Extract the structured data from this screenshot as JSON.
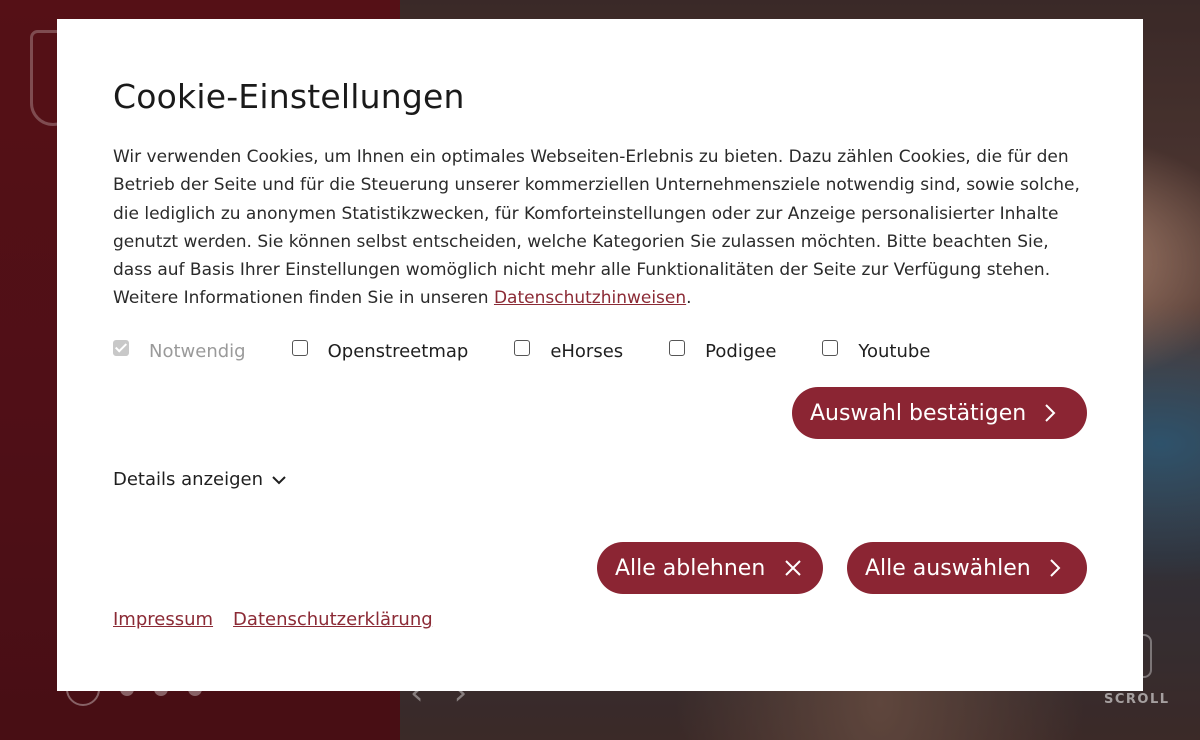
{
  "modal": {
    "title": "Cookie-Einstellungen",
    "text_before_link": "Wir verwenden Cookies, um Ihnen ein optimales Webseiten-Erlebnis zu bieten. Dazu zählen Cookies, die für den Betrieb der Seite und für die Steuerung unserer kommerziellen Unternehmensziele notwendig sind, sowie solche, die lediglich zu anonymen Statistikzwecken, für Komforteinstellungen oder zur Anzeige personalisierter Inhalte genutzt werden. Sie können selbst entscheiden, welche Kategorien Sie zulassen möchten. Bitte beachten Sie, dass auf Basis Ihrer Einstellungen womöglich nicht mehr alle Funktionalitäten der Seite zur Verfügung stehen. Weitere Informationen finden Sie in unseren ",
    "text_link": "Datenschutzhinweisen",
    "text_after_link": "."
  },
  "categories": [
    {
      "label": "Notwendig",
      "checked": true,
      "disabled": true
    },
    {
      "label": "Openstreetmap",
      "checked": false,
      "disabled": false
    },
    {
      "label": "eHorses",
      "checked": false,
      "disabled": false
    },
    {
      "label": "Podigee",
      "checked": false,
      "disabled": false
    },
    {
      "label": "Youtube",
      "checked": false,
      "disabled": false
    }
  ],
  "buttons": {
    "confirm_label": "Auswahl bestätigen",
    "reject_label": "Alle ablehnen",
    "accept_all_label": "Alle auswählen"
  },
  "details_label": "Details anzeigen",
  "footer": {
    "impressum": "Impressum",
    "privacy": "Datenschutzerklärung"
  },
  "background": {
    "scroll_label": "SCROLL"
  },
  "colors": {
    "accent": "#8b2533",
    "link": "#8b2a35",
    "backdrop": "#5a1218"
  },
  "icons": {
    "chevron_right": "chevron-right-icon",
    "close": "close-icon",
    "chevron_down": "chevron-down-icon"
  }
}
